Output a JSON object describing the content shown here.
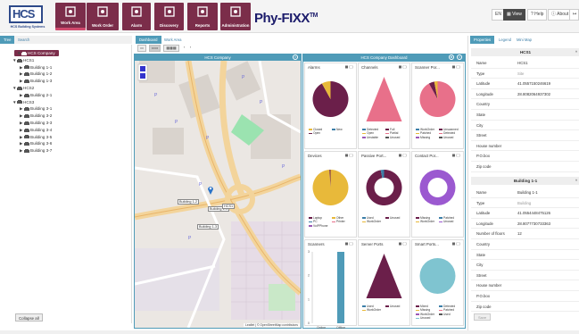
{
  "app": {
    "logo_text": "HCS",
    "logo_sub": "HCS Building Systems",
    "brand": "Phy-FIXX",
    "brand_tm": "TM"
  },
  "nav": [
    {
      "label": "Work Area",
      "icon": "building-icon",
      "active": true
    },
    {
      "label": "Work Order",
      "icon": "clipboard-icon",
      "active": false
    },
    {
      "label": "Alarm",
      "icon": "bell-icon",
      "active": false
    },
    {
      "label": "Discovery",
      "icon": "globe-icon",
      "active": false
    },
    {
      "label": "Reports",
      "icon": "report-icon",
      "active": false
    },
    {
      "label": "Administration",
      "icon": "gears-icon",
      "active": false
    }
  ],
  "topright": {
    "lang": "EN",
    "view": "View",
    "help": "Help",
    "about": "About"
  },
  "left": {
    "tabs": [
      "Tree",
      "Search"
    ],
    "tree": [
      {
        "label": "HCS Company",
        "level": 0,
        "arrow": "▼",
        "selected": true
      },
      {
        "label": "HCS1",
        "level": 1,
        "arrow": "▼"
      },
      {
        "label": "Building 1-1",
        "level": 2,
        "arrow": "▶"
      },
      {
        "label": "Building 1-2",
        "level": 2,
        "arrow": "▶"
      },
      {
        "label": "Building 1-3",
        "level": 2,
        "arrow": "▶"
      },
      {
        "label": "HCS2",
        "level": 1,
        "arrow": "▼"
      },
      {
        "label": "Building 2-1",
        "level": 2,
        "arrow": "▶"
      },
      {
        "label": "HCS3",
        "level": 1,
        "arrow": "▼"
      },
      {
        "label": "Building 3-1",
        "level": 2,
        "arrow": "▶"
      },
      {
        "label": "Building 3-2",
        "level": 2,
        "arrow": "▶"
      },
      {
        "label": "Building 3-3",
        "level": 2,
        "arrow": "▶"
      },
      {
        "label": "Building 3-4",
        "level": 2,
        "arrow": "▶"
      },
      {
        "label": "Building 3-5",
        "level": 2,
        "arrow": "▶"
      },
      {
        "label": "Building 3-6",
        "level": 2,
        "arrow": "▶"
      },
      {
        "label": "Building 3-7",
        "level": 2,
        "arrow": "▶"
      }
    ],
    "collapse_label": "Collapse all"
  },
  "center": {
    "tabs": [
      "Dashboard",
      "Work Area"
    ],
    "map_title": "HCS Company",
    "dash_title": "HCS Company Dashboard",
    "attribution": "Leaflet | © OpenStreetMap contributors",
    "map_labels": [
      "Building 1-2",
      "Building 1-1",
      "HCS1",
      "Building 1-3"
    ]
  },
  "cards": [
    {
      "title": "Alarms",
      "type": "pie",
      "colors": [
        "#6b1f4a",
        "#e8b93a"
      ],
      "values": [
        92,
        8
      ],
      "legend": [
        "Closed",
        "New",
        "Open"
      ],
      "legend_colors": [
        "#e8b93a",
        "#3d7fa8",
        "#6b1f4a"
      ]
    },
    {
      "title": "Channels",
      "type": "triangle",
      "color": "#e8708a",
      "legend": [
        "Detected",
        "Full",
        "Open",
        "Partial",
        "Unstable",
        "Unused"
      ],
      "legend_colors": [
        "#3d7fa8",
        "#6b1f4a",
        "#e8b93a",
        "#e8708a",
        "#9b59b6",
        "#555"
      ]
    },
    {
      "title": "Scanner Por...",
      "type": "pie",
      "colors": [
        "#e8708a",
        "#6b1f4a",
        "#e8b93a"
      ],
      "values": [
        92,
        5,
        3
      ],
      "legend": [
        "WorkOrder",
        "Unscanned",
        "Patched",
        "Detected",
        "Missing",
        "Unused"
      ],
      "legend_colors": [
        "#3d7fa8",
        "#6b1f4a",
        "#e8b93a",
        "#e8708a",
        "#9b59b6",
        "#555"
      ]
    },
    {
      "title": "Devices",
      "type": "pie",
      "colors": [
        "#e8b93a",
        "#6b1f4a"
      ],
      "values": [
        99,
        1
      ],
      "legend": [
        "Laptop",
        "Other",
        "PC",
        "Printer",
        "VoIPPhone"
      ],
      "legend_colors": [
        "#6b1f4a",
        "#e8b93a",
        "#3d7fa8",
        "#e8708a",
        "#9b59b6"
      ]
    },
    {
      "title": "Passive Port...",
      "type": "donut",
      "colors": [
        "#6b1f4a",
        "#3d7fa8"
      ],
      "values": [
        97,
        3
      ],
      "legend": [
        "Used",
        "Unused",
        "WorkOrder"
      ],
      "legend_colors": [
        "#3d7fa8",
        "#6b1f4a",
        "#e8b93a"
      ]
    },
    {
      "title": "Contact Por...",
      "type": "donut",
      "colors": [
        "#9b59d0",
        "#6b1f4a"
      ],
      "values": [
        100,
        0
      ],
      "legend": [
        "Missing",
        "Patched",
        "WorkOrder",
        "Unused"
      ],
      "legend_colors": [
        "#6b1f4a",
        "#3d7fa8",
        "#e8b93a",
        "#9b59d0"
      ]
    },
    {
      "title": "Scanners",
      "type": "bar",
      "bars": [
        {
          "label": "Online",
          "value": 0
        },
        {
          "label": "Offline",
          "value": 3
        }
      ],
      "ymax": 3
    },
    {
      "title": "Server Ports",
      "type": "triangle",
      "color": "#6b1f4a",
      "legend": [
        "Used",
        "Unused",
        "WorkOrder"
      ],
      "legend_colors": [
        "#3d7fa8",
        "#6b1f4a",
        "#e8b93a"
      ]
    },
    {
      "title": "Smart Ports...",
      "type": "circle",
      "color": "#7fc4d0",
      "legend": [
        "Mixed",
        "Detected",
        "Missing",
        "Patched",
        "WorkOrder",
        "Used",
        "Unused"
      ],
      "legend_colors": [
        "#6b1f4a",
        "#3d7fa8",
        "#e8b93a",
        "#e8708a",
        "#9b59b6",
        "#555",
        "#7fc4d0"
      ]
    }
  ],
  "right": {
    "tabs": [
      "Properties",
      "Legend",
      "Mini Map"
    ],
    "sec1": "HCS1",
    "props1": [
      {
        "k": "Name",
        "v": "HCS1"
      },
      {
        "k": "Type",
        "v": "Site",
        "g": true
      },
      {
        "k": "Latitude",
        "v": "41.0557150246619"
      },
      {
        "k": "Longitude",
        "v": "28.8082064937302"
      },
      {
        "k": "Country",
        "v": ""
      },
      {
        "k": "State",
        "v": ""
      },
      {
        "k": "City",
        "v": ""
      },
      {
        "k": "Street",
        "v": ""
      },
      {
        "k": "House number",
        "v": ""
      },
      {
        "k": "P.O.box",
        "v": ""
      },
      {
        "k": "Zip code",
        "v": ""
      }
    ],
    "sec2": "Building 1-1",
    "props2": [
      {
        "k": "Name",
        "v": "Building 1-1"
      },
      {
        "k": "Type",
        "v": "Building",
        "g": true
      },
      {
        "k": "Latitude",
        "v": "41.0554448475126"
      },
      {
        "k": "Longitude",
        "v": "28.8077730733363"
      },
      {
        "k": "Number of floors",
        "v": "12"
      },
      {
        "k": "Country",
        "v": ""
      },
      {
        "k": "State",
        "v": ""
      },
      {
        "k": "City",
        "v": ""
      },
      {
        "k": "Street",
        "v": ""
      },
      {
        "k": "House number",
        "v": ""
      },
      {
        "k": "P.O.box",
        "v": ""
      },
      {
        "k": "Zip code",
        "v": ""
      }
    ],
    "save": "Save"
  }
}
